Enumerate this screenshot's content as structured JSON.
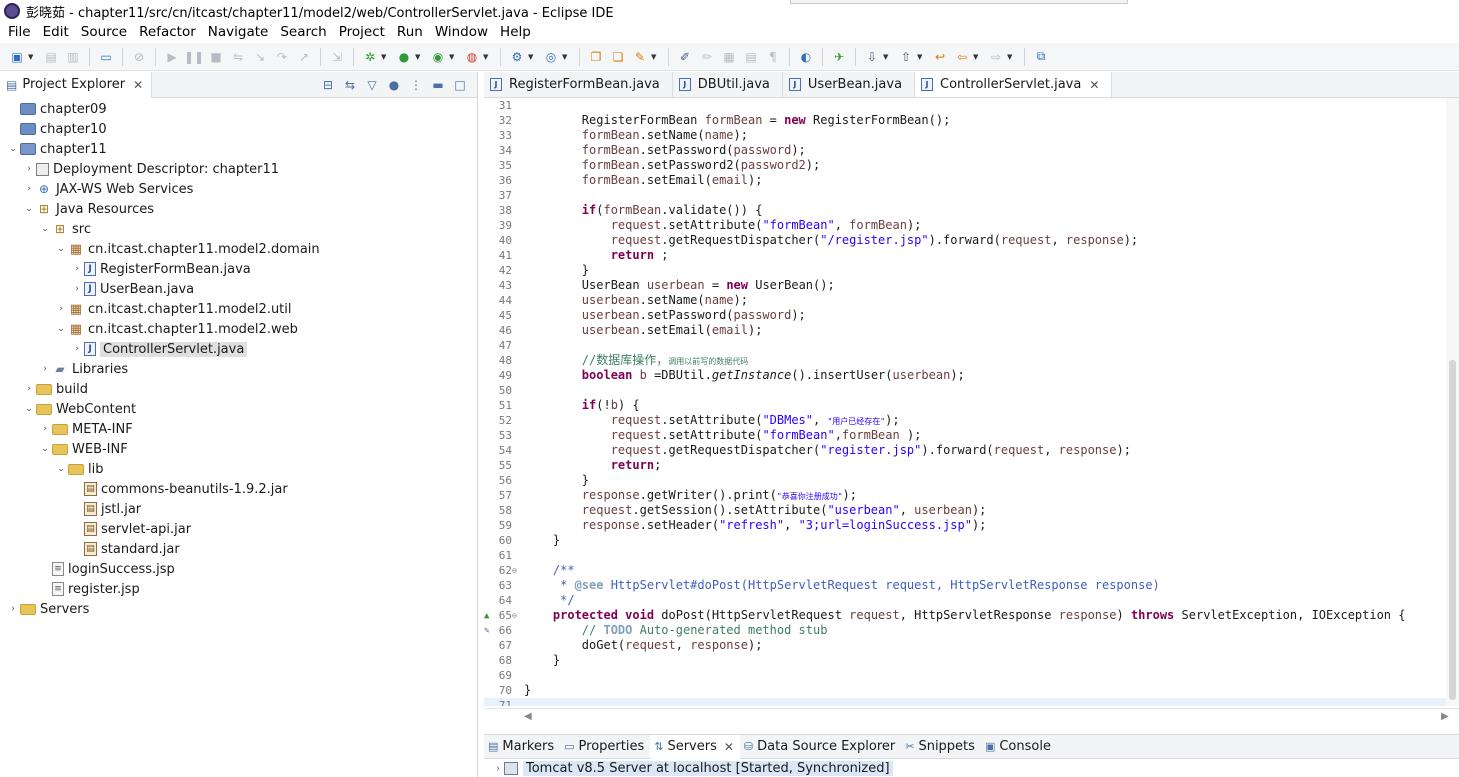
{
  "window": {
    "title": "彭晓茹 - chapter11/src/cn/itcast/chapter11/model2/web/ControllerServlet.java - Eclipse IDE"
  },
  "menu": [
    "File",
    "Edit",
    "Source",
    "Refactor",
    "Navigate",
    "Search",
    "Project",
    "Run",
    "Window",
    "Help"
  ],
  "project_explorer": {
    "tab_label": "Project Explorer",
    "tab_close": "✕",
    "tree": [
      {
        "label": "chapter09",
        "depth": 0,
        "twisty": "",
        "icon": "project"
      },
      {
        "label": "chapter10",
        "depth": 0,
        "twisty": "",
        "icon": "project"
      },
      {
        "label": "chapter11",
        "depth": 0,
        "twisty": "v",
        "icon": "webproj"
      },
      {
        "label": "Deployment Descriptor: chapter11",
        "depth": 1,
        "twisty": ">",
        "icon": "dd"
      },
      {
        "label": "JAX-WS Web Services",
        "depth": 1,
        "twisty": ">",
        "icon": "ws"
      },
      {
        "label": "Java Resources",
        "depth": 1,
        "twisty": "v",
        "icon": "src"
      },
      {
        "label": "src",
        "depth": 2,
        "twisty": "v",
        "icon": "src"
      },
      {
        "label": "cn.itcast.chapter11.model2.domain",
        "depth": 3,
        "twisty": "v",
        "icon": "pkg"
      },
      {
        "label": "RegisterFormBean.java",
        "depth": 4,
        "twisty": ">",
        "icon": "java"
      },
      {
        "label": "UserBean.java",
        "depth": 4,
        "twisty": ">",
        "icon": "java"
      },
      {
        "label": "cn.itcast.chapter11.model2.util",
        "depth": 3,
        "twisty": ">",
        "icon": "pkg"
      },
      {
        "label": "cn.itcast.chapter11.model2.web",
        "depth": 3,
        "twisty": "v",
        "icon": "pkg"
      },
      {
        "label": "ControllerServlet.java",
        "depth": 4,
        "twisty": ">",
        "icon": "java",
        "selected": true
      },
      {
        "label": "Libraries",
        "depth": 2,
        "twisty": ">",
        "icon": "lib"
      },
      {
        "label": "build",
        "depth": 1,
        "twisty": ">",
        "icon": "folder"
      },
      {
        "label": "WebContent",
        "depth": 1,
        "twisty": "v",
        "icon": "folder"
      },
      {
        "label": "META-INF",
        "depth": 2,
        "twisty": ">",
        "icon": "folder"
      },
      {
        "label": "WEB-INF",
        "depth": 2,
        "twisty": "v",
        "icon": "folder"
      },
      {
        "label": "lib",
        "depth": 3,
        "twisty": "v",
        "icon": "folder"
      },
      {
        "label": "commons-beanutils-1.9.2.jar",
        "depth": 4,
        "twisty": "",
        "icon": "jar"
      },
      {
        "label": "jstl.jar",
        "depth": 4,
        "twisty": "",
        "icon": "jar"
      },
      {
        "label": "servlet-api.jar",
        "depth": 4,
        "twisty": "",
        "icon": "jar"
      },
      {
        "label": "standard.jar",
        "depth": 4,
        "twisty": "",
        "icon": "jar"
      },
      {
        "label": "loginSuccess.jsp",
        "depth": 2,
        "twisty": "",
        "icon": "jsp"
      },
      {
        "label": "register.jsp",
        "depth": 2,
        "twisty": "",
        "icon": "jsp"
      },
      {
        "label": "Servers",
        "depth": 0,
        "twisty": ">",
        "icon": "srv"
      }
    ]
  },
  "editor": {
    "tabs": [
      {
        "label": "RegisterFormBean.java",
        "active": false,
        "closable": false
      },
      {
        "label": "DBUtil.java",
        "active": false,
        "closable": false
      },
      {
        "label": "UserBean.java",
        "active": false,
        "closable": false
      },
      {
        "label": "ControllerServlet.java",
        "active": true,
        "closable": true
      }
    ],
    "close_glyph": "✕",
    "lines": [
      {
        "n": "31",
        "tokens": []
      },
      {
        "n": "32",
        "tokens": [
          [
            "t",
            "        RegisterFormBean "
          ],
          [
            "var",
            "formBean"
          ],
          [
            "t",
            " = "
          ],
          [
            "kw",
            "new"
          ],
          [
            "t",
            " RegisterFormBean();"
          ]
        ]
      },
      {
        "n": "33",
        "tokens": [
          [
            "t",
            "        "
          ],
          [
            "var",
            "formBean"
          ],
          [
            "t",
            ".setName("
          ],
          [
            "var",
            "name"
          ],
          [
            "t",
            ");"
          ]
        ]
      },
      {
        "n": "34",
        "tokens": [
          [
            "t",
            "        "
          ],
          [
            "var",
            "formBean"
          ],
          [
            "t",
            ".setPassword("
          ],
          [
            "var",
            "password"
          ],
          [
            "t",
            ");"
          ]
        ]
      },
      {
        "n": "35",
        "tokens": [
          [
            "t",
            "        "
          ],
          [
            "var",
            "formBean"
          ],
          [
            "t",
            ".setPassword2("
          ],
          [
            "var",
            "password2"
          ],
          [
            "t",
            ");"
          ]
        ]
      },
      {
        "n": "36",
        "tokens": [
          [
            "t",
            "        "
          ],
          [
            "var",
            "formBean"
          ],
          [
            "t",
            ".setEmail("
          ],
          [
            "var",
            "email"
          ],
          [
            "t",
            ");"
          ]
        ]
      },
      {
        "n": "37",
        "tokens": []
      },
      {
        "n": "38",
        "tokens": [
          [
            "t",
            "        "
          ],
          [
            "kw",
            "if"
          ],
          [
            "t",
            "("
          ],
          [
            "var",
            "formBean"
          ],
          [
            "t",
            ".validate()) {"
          ]
        ]
      },
      {
        "n": "39",
        "tokens": [
          [
            "t",
            "            "
          ],
          [
            "var",
            "request"
          ],
          [
            "t",
            ".setAttribute("
          ],
          [
            "str",
            "\"formBean\""
          ],
          [
            "t",
            ", "
          ],
          [
            "var",
            "formBean"
          ],
          [
            "t",
            ");"
          ]
        ]
      },
      {
        "n": "40",
        "tokens": [
          [
            "t",
            "            "
          ],
          [
            "var",
            "request"
          ],
          [
            "t",
            ".getRequestDispatcher("
          ],
          [
            "str",
            "\"/register.jsp\""
          ],
          [
            "t",
            ").forward("
          ],
          [
            "var",
            "request"
          ],
          [
            "t",
            ", "
          ],
          [
            "var",
            "response"
          ],
          [
            "t",
            ");"
          ]
        ]
      },
      {
        "n": "41",
        "tokens": [
          [
            "t",
            "            "
          ],
          [
            "kw",
            "return"
          ],
          [
            "t",
            " ;"
          ]
        ]
      },
      {
        "n": "42",
        "tokens": [
          [
            "t",
            "        }"
          ]
        ]
      },
      {
        "n": "43",
        "tokens": [
          [
            "t",
            "        UserBean "
          ],
          [
            "var",
            "userbean"
          ],
          [
            "t",
            " = "
          ],
          [
            "kw",
            "new"
          ],
          [
            "t",
            " UserBean();"
          ]
        ]
      },
      {
        "n": "44",
        "tokens": [
          [
            "t",
            "        "
          ],
          [
            "var",
            "userbean"
          ],
          [
            "t",
            ".setName("
          ],
          [
            "var",
            "name"
          ],
          [
            "t",
            ");"
          ]
        ]
      },
      {
        "n": "45",
        "tokens": [
          [
            "t",
            "        "
          ],
          [
            "var",
            "userbean"
          ],
          [
            "t",
            ".setPassword("
          ],
          [
            "var",
            "password"
          ],
          [
            "t",
            ");"
          ]
        ]
      },
      {
        "n": "46",
        "tokens": [
          [
            "t",
            "        "
          ],
          [
            "var",
            "userbean"
          ],
          [
            "t",
            ".setEmail("
          ],
          [
            "var",
            "email"
          ],
          [
            "t",
            ");"
          ]
        ]
      },
      {
        "n": "47",
        "tokens": []
      },
      {
        "n": "48",
        "tokens": [
          [
            "t",
            "        "
          ],
          [
            "cmtbig",
            "//数据库操作，"
          ],
          [
            "cmtsmall",
            "调用以前写的数据代码"
          ]
        ]
      },
      {
        "n": "49",
        "tokens": [
          [
            "t",
            "        "
          ],
          [
            "kw",
            "boolean"
          ],
          [
            "t",
            " "
          ],
          [
            "var",
            "b"
          ],
          [
            "t",
            " =DBUtil."
          ],
          [
            "it",
            "getInstance"
          ],
          [
            "t",
            "().insertUser("
          ],
          [
            "var",
            "userbean"
          ],
          [
            "t",
            ");"
          ]
        ]
      },
      {
        "n": "50",
        "tokens": []
      },
      {
        "n": "51",
        "tokens": [
          [
            "t",
            "        "
          ],
          [
            "kw",
            "if"
          ],
          [
            "t",
            "(!"
          ],
          [
            "var",
            "b"
          ],
          [
            "t",
            ") {"
          ]
        ]
      },
      {
        "n": "52",
        "tokens": [
          [
            "t",
            "            "
          ],
          [
            "var",
            "request"
          ],
          [
            "t",
            ".setAttribute("
          ],
          [
            "str",
            "\"DBMes\""
          ],
          [
            "t",
            ", "
          ],
          [
            "strsmall",
            "\"用户已经存在\""
          ],
          [
            "t",
            ");"
          ]
        ]
      },
      {
        "n": "53",
        "tokens": [
          [
            "t",
            "            "
          ],
          [
            "var",
            "request"
          ],
          [
            "t",
            ".setAttribute("
          ],
          [
            "str",
            "\"formBean\""
          ],
          [
            "t",
            ","
          ],
          [
            "var",
            "formBean"
          ],
          [
            "t",
            " );"
          ]
        ]
      },
      {
        "n": "54",
        "tokens": [
          [
            "t",
            "            "
          ],
          [
            "var",
            "request"
          ],
          [
            "t",
            ".getRequestDispatcher("
          ],
          [
            "str",
            "\"register.jsp\""
          ],
          [
            "t",
            ").forward("
          ],
          [
            "var",
            "request"
          ],
          [
            "t",
            ", "
          ],
          [
            "var",
            "response"
          ],
          [
            "t",
            ");"
          ]
        ]
      },
      {
        "n": "55",
        "tokens": [
          [
            "t",
            "            "
          ],
          [
            "kw",
            "return"
          ],
          [
            "t",
            ";"
          ]
        ]
      },
      {
        "n": "56",
        "tokens": [
          [
            "t",
            "        }"
          ]
        ]
      },
      {
        "n": "57",
        "tokens": [
          [
            "t",
            "        "
          ],
          [
            "var",
            "response"
          ],
          [
            "t",
            ".getWriter().print("
          ],
          [
            "strsmall",
            "\"恭喜你注册成功\""
          ],
          [
            "t",
            ");"
          ]
        ]
      },
      {
        "n": "58",
        "tokens": [
          [
            "t",
            "        "
          ],
          [
            "var",
            "request"
          ],
          [
            "t",
            ".getSession().setAttribute("
          ],
          [
            "str",
            "\"userbean\""
          ],
          [
            "t",
            ", "
          ],
          [
            "var",
            "userbean"
          ],
          [
            "t",
            ");"
          ]
        ]
      },
      {
        "n": "59",
        "tokens": [
          [
            "t",
            "        "
          ],
          [
            "var",
            "response"
          ],
          [
            "t",
            ".setHeader("
          ],
          [
            "str",
            "\"refresh\""
          ],
          [
            "t",
            ", "
          ],
          [
            "str",
            "\"3;url=loginSuccess.jsp\""
          ],
          [
            "t",
            ");"
          ]
        ]
      },
      {
        "n": "60",
        "tokens": [
          [
            "t",
            "    }"
          ]
        ]
      },
      {
        "n": "61",
        "tokens": []
      },
      {
        "n": "62",
        "fold": "⊖",
        "tokens": [
          [
            "t",
            "    "
          ],
          [
            "doc",
            "/**"
          ]
        ]
      },
      {
        "n": "63",
        "tokens": [
          [
            "doc",
            "     * "
          ],
          [
            "tag",
            "@see"
          ],
          [
            "doc",
            " HttpServlet#doPost(HttpServletRequest request, HttpServletResponse response)"
          ]
        ]
      },
      {
        "n": "64",
        "tokens": [
          [
            "doc",
            "     */"
          ]
        ]
      },
      {
        "n": "65",
        "fold": "⊖",
        "mark": "▲",
        "tokens": [
          [
            "t",
            "    "
          ],
          [
            "kw",
            "protected"
          ],
          [
            "t",
            " "
          ],
          [
            "kw",
            "void"
          ],
          [
            "t",
            " doPost(HttpServletRequest "
          ],
          [
            "var",
            "request"
          ],
          [
            "t",
            ", HttpServletResponse "
          ],
          [
            "var",
            "response"
          ],
          [
            "t",
            ") "
          ],
          [
            "kw",
            "throws"
          ],
          [
            "t",
            " ServletException, IOException {"
          ]
        ]
      },
      {
        "n": "66",
        "mark": "✎",
        "tokens": [
          [
            "t",
            "        "
          ],
          [
            "cmt",
            "// "
          ],
          [
            "cmtb",
            "TODO"
          ],
          [
            "cmt",
            " Auto-generated method stub"
          ]
        ]
      },
      {
        "n": "67",
        "tokens": [
          [
            "t",
            "        doGet("
          ],
          [
            "var",
            "request"
          ],
          [
            "t",
            ", "
          ],
          [
            "var",
            "response"
          ],
          [
            "t",
            ");"
          ]
        ]
      },
      {
        "n": "68",
        "tokens": [
          [
            "t",
            "    }"
          ]
        ]
      },
      {
        "n": "69",
        "tokens": []
      },
      {
        "n": "70",
        "tokens": [
          [
            "t",
            "}"
          ]
        ]
      },
      {
        "n": "71",
        "current": true,
        "tokens": []
      }
    ]
  },
  "bottom_panel": {
    "tabs": [
      {
        "label": "Markers",
        "icon": "markers-icon",
        "active": false
      },
      {
        "label": "Properties",
        "icon": "properties-icon",
        "active": false
      },
      {
        "label": "Servers",
        "icon": "servers-icon",
        "active": true
      },
      {
        "label": "Data Source Explorer",
        "icon": "data-source-icon",
        "active": false
      },
      {
        "label": "Snippets",
        "icon": "snippets-icon",
        "active": false
      },
      {
        "label": "Console",
        "icon": "console-icon",
        "active": false
      }
    ],
    "server_entry": "Tomcat v8.5 Server at localhost  [Started, Synchronized]"
  }
}
